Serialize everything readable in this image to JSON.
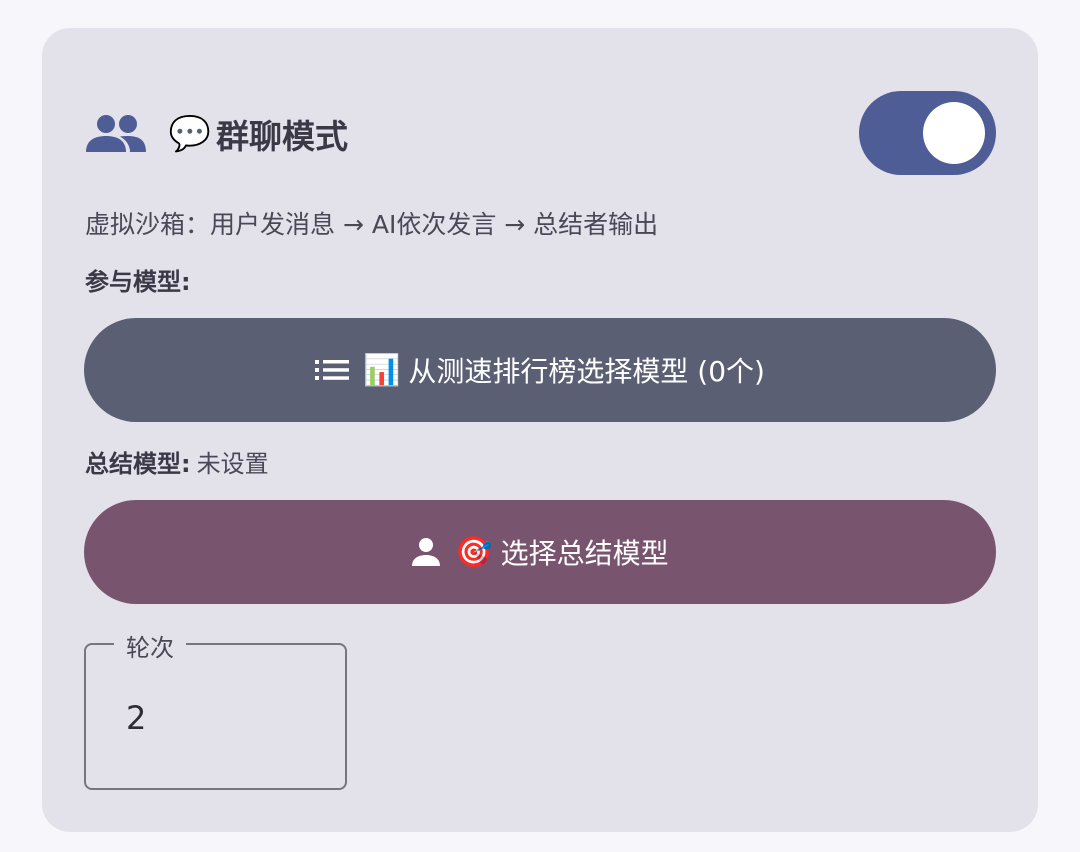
{
  "header": {
    "icon": "group-icon",
    "emoji": "💬",
    "title": "群聊模式"
  },
  "toggle": {
    "state": "on",
    "color": "#4e5d96"
  },
  "description": "虚拟沙箱：用户发消息 → AI依次发言 → 总结者输出",
  "participants": {
    "label": "参与模型:",
    "button": {
      "icon": "list-icon",
      "emoji": "📊",
      "label": "从测速排行榜选择模型 (0个)",
      "color": "#5b5f73"
    }
  },
  "summary": {
    "label": "总结模型:",
    "value": "未设置",
    "button": {
      "icon": "person-icon",
      "emoji": "🎯",
      "label": "选择总结模型",
      "color": "#78546e"
    }
  },
  "rounds": {
    "label": "轮次",
    "value": "2"
  }
}
